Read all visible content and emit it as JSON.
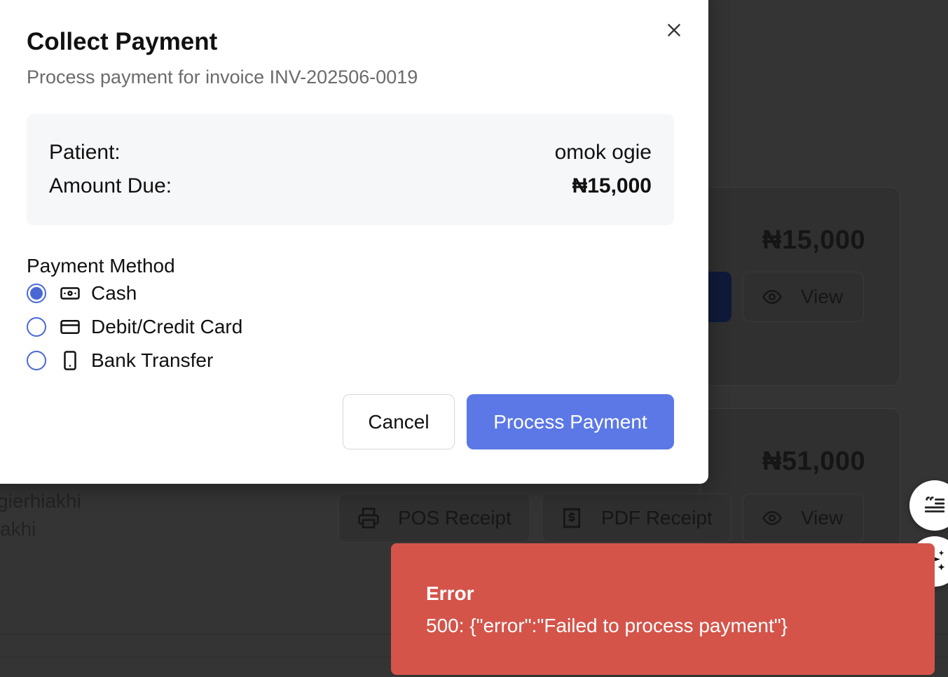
{
  "modal": {
    "title": "Collect Payment",
    "subtitle": "Process payment for invoice INV-202506-0019",
    "patient_label": "Patient:",
    "patient_value": "omok ogie",
    "amount_label": "Amount Due:",
    "amount_value": "₦15,000",
    "payment_method_label": "Payment Method",
    "methods": [
      {
        "label": "Cash",
        "icon": "cash-icon",
        "selected": true
      },
      {
        "label": "Debit/Credit Card",
        "icon": "credit-card-icon",
        "selected": false
      },
      {
        "label": "Bank Transfer",
        "icon": "smartphone-icon",
        "selected": false
      }
    ],
    "cancel_label": "Cancel",
    "process_label": "Process Payment"
  },
  "background": {
    "invoice1_amount": "₦15,000",
    "invoice1_view_label": "View",
    "invoice2_amount": "₦51,000",
    "pos_receipt_label": "POS Receipt",
    "pdf_receipt_label": "PDF Receipt",
    "invoice2_view_label": "View",
    "partial_text_1": "gierhiakhi",
    "partial_text_2": "akhi"
  },
  "toast": {
    "title": "Error",
    "message": "500: {\"error\":\"Failed to process payment\"}"
  },
  "colors": {
    "accent": "#5b78e6",
    "radio": "#4a67d6",
    "error": "#d4544a",
    "overlay": "#343434"
  }
}
